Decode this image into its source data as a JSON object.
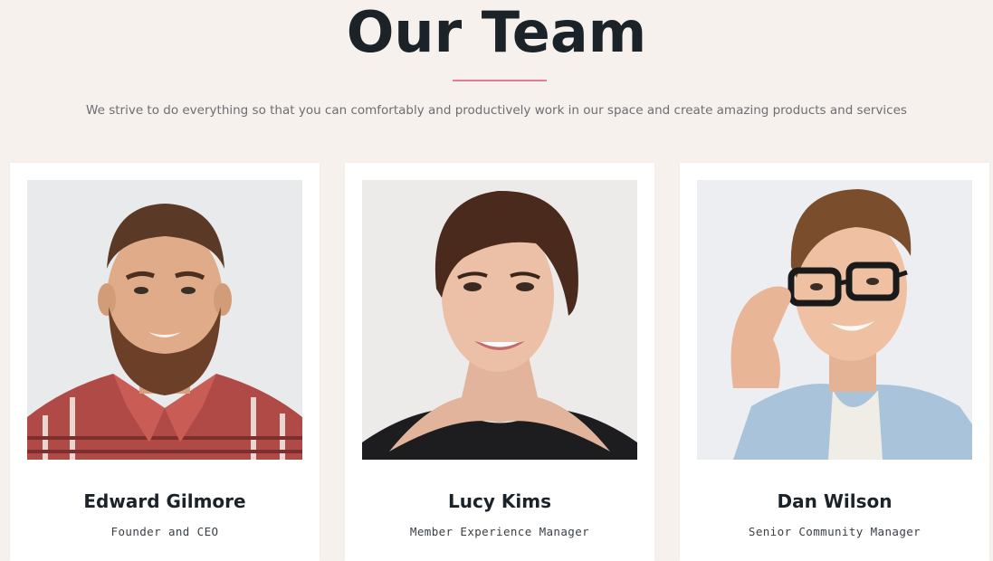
{
  "section": {
    "title": "Our Team",
    "subtitle": "We strive to do everything so that you can comfortably and productively work in our space and create amazing products and services",
    "accent_color": "#e27b9c",
    "background_color": "#f6f1ec"
  },
  "team": [
    {
      "name": "Edward Gilmore",
      "role": "Founder and CEO"
    },
    {
      "name": "Lucy Kims",
      "role": "Member Experience Manager"
    },
    {
      "name": "Dan Wilson",
      "role": "Senior Community Manager"
    }
  ]
}
